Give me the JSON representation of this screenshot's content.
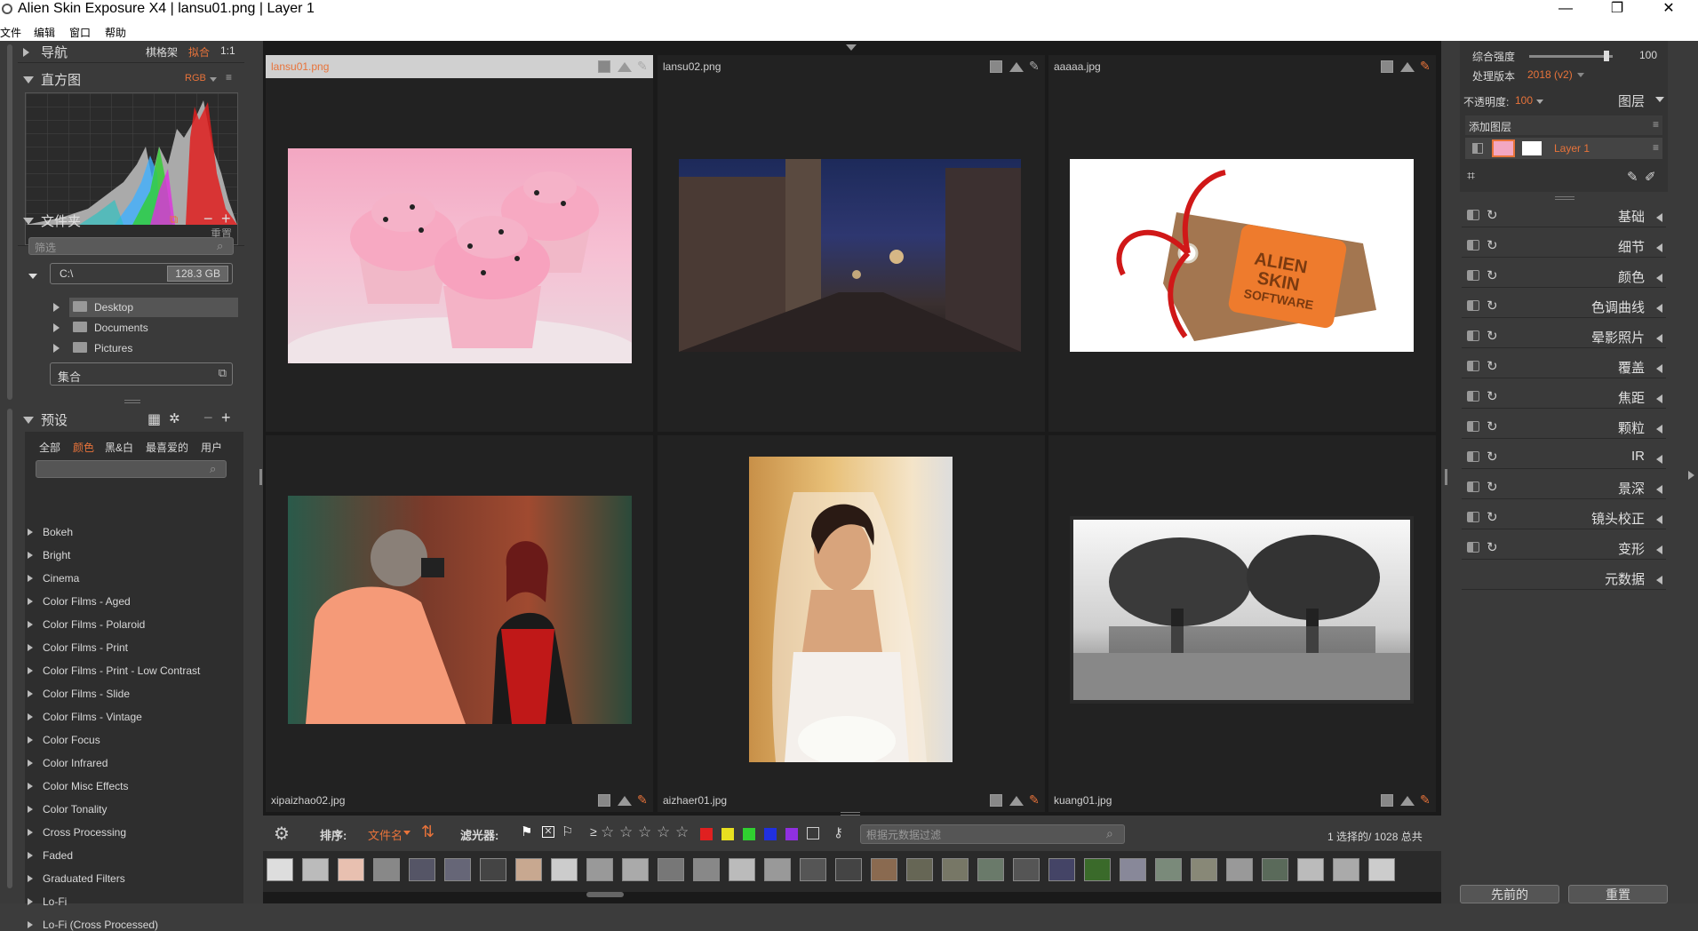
{
  "window": {
    "title": "Alien Skin Exposure X4 | lansu01.png | Layer 1",
    "minimize": "—",
    "restore": "❐",
    "close": "✕"
  },
  "menu": [
    "文件",
    "编辑",
    "窗口",
    "帮助"
  ],
  "left": {
    "nav": {
      "title": "导航",
      "opt1": "棋格架",
      "opt2": "拟合",
      "opt3": "1:1"
    },
    "histogram": {
      "title": "直方图",
      "mode": "RGB",
      "reset": "重置"
    },
    "folders": {
      "title": "文件夹",
      "filter_placeholder": "筛选",
      "drive": "C:\\",
      "drive_size": "128.3 GB",
      "items": [
        "Desktop",
        "Documents",
        "Pictures"
      ],
      "collections": "集合"
    },
    "presets": {
      "title": "预设",
      "tabs": [
        "全部",
        "颜色",
        "黑&白",
        "最喜爱的",
        "用户"
      ],
      "active_tab": 1,
      "items": [
        "Bokeh",
        "Bright",
        "Cinema",
        "Color Films - Aged",
        "Color Films - Polaroid",
        "Color Films - Print",
        "Color Films - Print - Low Contrast",
        "Color Films - Slide",
        "Color Films - Vintage",
        "Color Focus",
        "Color Infrared",
        "Color Misc Effects",
        "Color Tonality",
        "Cross Processing",
        "Faded",
        "Graduated Filters",
        "Lo-Fi",
        "Lo-Fi (Cross Processed)"
      ]
    }
  },
  "grid": {
    "cells": [
      {
        "name": "lansu01.png",
        "pinned": false,
        "selected": true
      },
      {
        "name": "lansu02.png",
        "pinned": false,
        "selected": false
      },
      {
        "name": "aaaaa.jpg",
        "pinned": true,
        "selected": false
      },
      {
        "name": "xipaizhao02.jpg",
        "pinned": true,
        "selected": false
      },
      {
        "name": "aizhaer01.jpg",
        "pinned": true,
        "selected": false
      },
      {
        "name": "kuang01.jpg",
        "pinned": true,
        "selected": false
      }
    ]
  },
  "filterbar": {
    "sort_label": "排序:",
    "sort_value": "文件名",
    "filter_label": "滤光器:",
    "rating_prefix": "≥",
    "search_placeholder": "根据元数据过滤",
    "count": "1 选择的/ 1028 总共",
    "colors": [
      "#e02020",
      "#e8e020",
      "#30d030",
      "#2030e0",
      "#9030e0"
    ]
  },
  "right": {
    "overall_label": "综合强度",
    "overall_value": "100",
    "overall_level": 0.93,
    "process_label": "处理版本",
    "process_value": "2018 (v2)",
    "opacity_label": "不透明度:",
    "opacity_value": "100",
    "layers_label": "图层",
    "add_layer": "添加图层",
    "layer_name": "Layer 1",
    "sections": [
      "基础",
      "细节",
      "颜色",
      "色调曲线",
      "晕影照片",
      "覆盖",
      "焦距",
      "颗粒",
      "IR",
      "景深",
      "镜头校正",
      "变形"
    ],
    "metadata": "元数据",
    "prev_button": "先前的",
    "reset_button": "重置"
  },
  "cupcake_brand": [
    "ALIEN",
    "SKIN",
    "SOFTWARE"
  ]
}
